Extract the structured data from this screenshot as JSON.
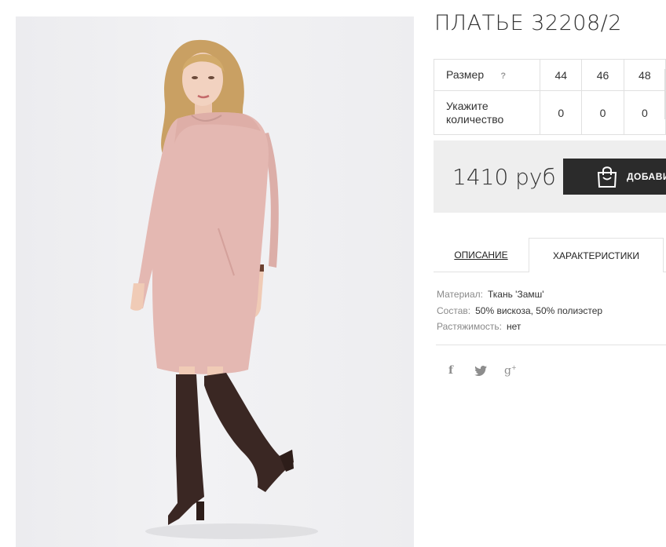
{
  "product": {
    "title": "ПЛАТЬЕ 32208/2",
    "image_alt": "Платье 32208/2"
  },
  "sizes": {
    "size_label": "Размер",
    "help": "?",
    "values": [
      "44",
      "46",
      "48"
    ],
    "qty_label": "Укажите количество",
    "quantities": [
      "0",
      "0",
      "0"
    ]
  },
  "purchase": {
    "price": "1410 руб",
    "add_label": "ДОБАВИТЬ"
  },
  "tabs": [
    {
      "label": "ОПИСАНИЕ",
      "active": false
    },
    {
      "label": "ХАРАКТЕРИСТИКИ",
      "active": true
    }
  ],
  "specs": [
    {
      "key": "Материал:",
      "value": "Ткань 'Замш'"
    },
    {
      "key": "Состав:",
      "value": "50% вискоза, 50% полиэстер"
    },
    {
      "key": "Растяжимость:",
      "value": "нет"
    }
  ],
  "share": [
    {
      "icon": "facebook-icon",
      "glyph": "f"
    },
    {
      "icon": "twitter-icon",
      "glyph": "bird"
    },
    {
      "icon": "google-plus-icon",
      "glyph": "g+"
    }
  ],
  "colors": {
    "dress": "#e4b8b2",
    "boots": "#3a2723",
    "button": "#2b2b2b",
    "price_box": "#eeeeee"
  }
}
